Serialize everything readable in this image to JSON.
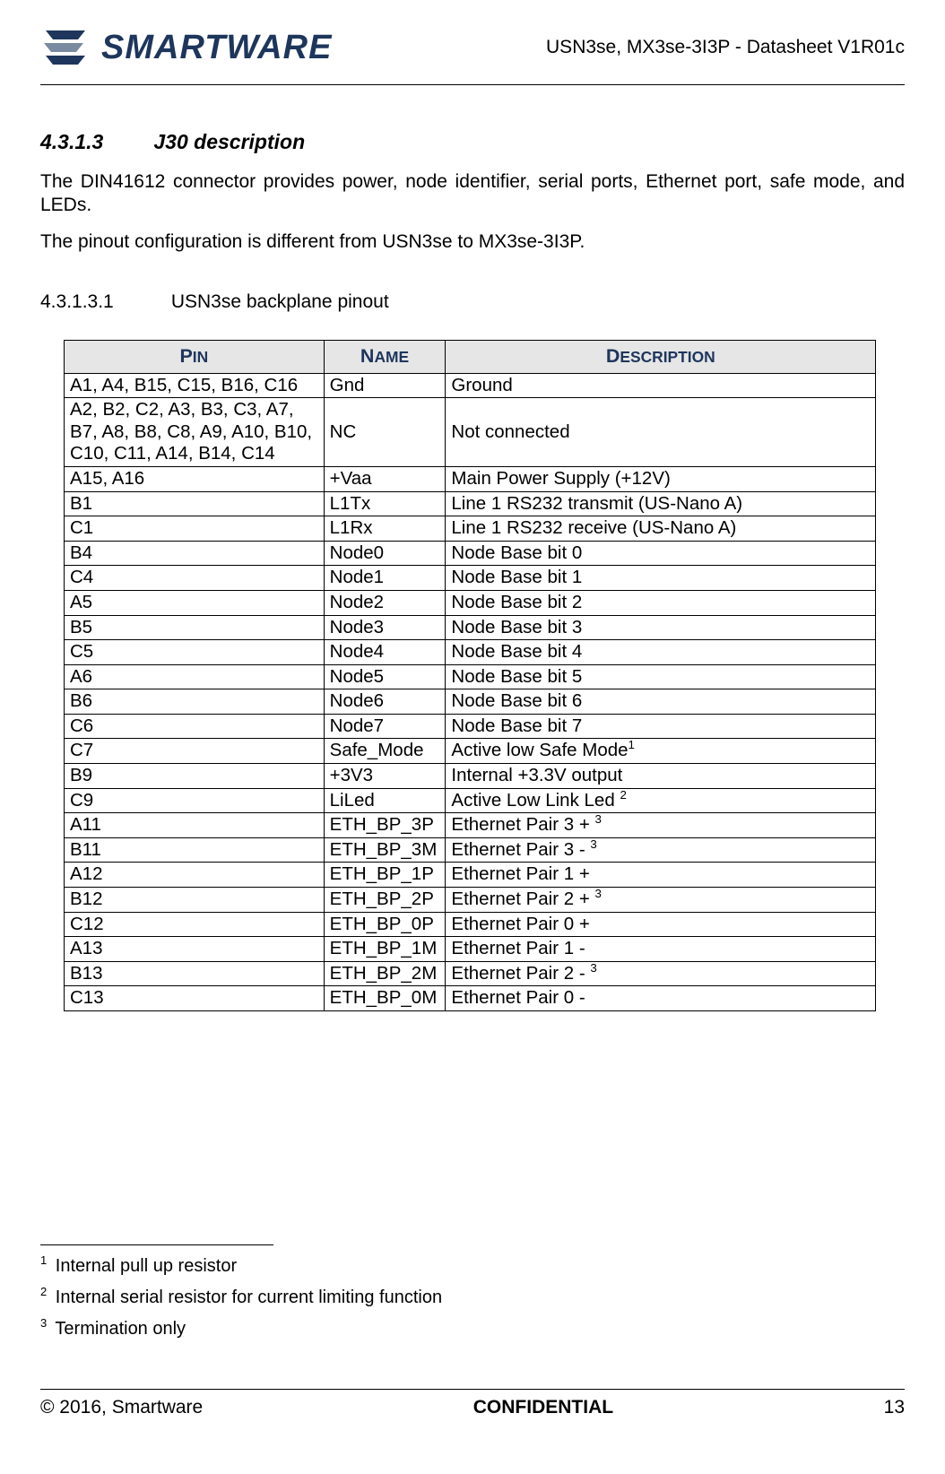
{
  "header": {
    "logo_text": "SMARTWARE",
    "doc_id": "USN3se, MX3se-3I3P - Datasheet V1R01c"
  },
  "section": {
    "number": "4.3.1.3",
    "title": "J30 description",
    "para1": "The DIN41612 connector provides power, node identifier, serial ports, Ethernet port, safe mode, and LEDs.",
    "para2": "The pinout configuration is different from USN3se to MX3se-3I3P."
  },
  "subsection": {
    "number": "4.3.1.3.1",
    "title": "USN3se backplane pinout"
  },
  "table": {
    "headers": {
      "pin": "Pin",
      "name": "Name",
      "description": "Description"
    },
    "rows": [
      {
        "pin": "A1, A4, B15, C15, B16, C16",
        "name": "Gnd",
        "desc": "Ground",
        "sup": ""
      },
      {
        "pin": "A2, B2, C2, A3, B3, C3, A7, B7, A8, B8, C8, A9, A10, B10, C10, C11, A14, B14, C14",
        "name": "NC",
        "desc": "Not connected",
        "sup": ""
      },
      {
        "pin": "A15, A16",
        "name": "+Vaa",
        "desc": "Main Power Supply (+12V)",
        "sup": ""
      },
      {
        "pin": "B1",
        "name": "L1Tx",
        "desc": "Line 1 RS232 transmit (US-Nano A)",
        "sup": ""
      },
      {
        "pin": "C1",
        "name": "L1Rx",
        "desc": "Line 1 RS232 receive (US-Nano A)",
        "sup": ""
      },
      {
        "pin": "B4",
        "name": "Node0",
        "desc": "Node Base bit 0",
        "sup": ""
      },
      {
        "pin": "C4",
        "name": "Node1",
        "desc": "Node Base bit 1",
        "sup": ""
      },
      {
        "pin": "A5",
        "name": "Node2",
        "desc": "Node Base bit 2",
        "sup": ""
      },
      {
        "pin": "B5",
        "name": "Node3",
        "desc": "Node Base bit 3",
        "sup": ""
      },
      {
        "pin": "C5",
        "name": "Node4",
        "desc": "Node Base bit 4",
        "sup": ""
      },
      {
        "pin": "A6",
        "name": "Node5",
        "desc": "Node Base bit 5",
        "sup": ""
      },
      {
        "pin": "B6",
        "name": "Node6",
        "desc": "Node Base bit 6",
        "sup": ""
      },
      {
        "pin": "C6",
        "name": "Node7",
        "desc": "Node Base bit 7",
        "sup": ""
      },
      {
        "pin": "C7",
        "name": "Safe_Mode",
        "desc": "Active low Safe Mode",
        "sup": "1"
      },
      {
        "pin": "B9",
        "name": "+3V3",
        "desc": "Internal +3.3V output",
        "sup": ""
      },
      {
        "pin": "C9",
        "name": "LiLed",
        "desc": "Active Low Link Led ",
        "sup": "2"
      },
      {
        "pin": "A11",
        "name": "ETH_BP_3P",
        "desc": "Ethernet Pair 3 + ",
        "sup": "3"
      },
      {
        "pin": "B11",
        "name": "ETH_BP_3M",
        "desc": "Ethernet Pair 3 - ",
        "sup": "3"
      },
      {
        "pin": "A12",
        "name": "ETH_BP_1P",
        "desc": "Ethernet Pair 1 +",
        "sup": ""
      },
      {
        "pin": "B12",
        "name": "ETH_BP_2P",
        "desc": "Ethernet Pair 2 + ",
        "sup": "3"
      },
      {
        "pin": "C12",
        "name": "ETH_BP_0P",
        "desc": "Ethernet Pair 0 +",
        "sup": ""
      },
      {
        "pin": "A13",
        "name": "ETH_BP_1M",
        "desc": "Ethernet Pair 1 -",
        "sup": ""
      },
      {
        "pin": "B13",
        "name": "ETH_BP_2M",
        "desc": "Ethernet Pair 2 - ",
        "sup": "3"
      },
      {
        "pin": "C13",
        "name": "ETH_BP_0M",
        "desc": "Ethernet Pair 0 -",
        "sup": ""
      }
    ]
  },
  "footnotes": [
    {
      "num": "1",
      "text": "Internal pull up resistor"
    },
    {
      "num": "2",
      "text": "Internal serial resistor for current limiting function"
    },
    {
      "num": "3",
      "text": "Termination only"
    }
  ],
  "footer": {
    "left": "© 2016, Smartware",
    "mid": "CONFIDENTIAL",
    "right": "13"
  }
}
